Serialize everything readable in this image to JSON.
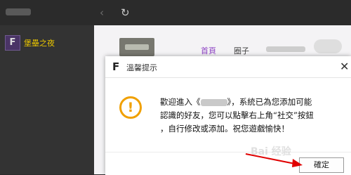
{
  "sidebar": {
    "items": [
      {
        "logo": "F",
        "label": "堡壘之夜"
      }
    ]
  },
  "nav": {
    "tabs": [
      {
        "label": "首頁"
      },
      {
        "label": "圈子"
      }
    ]
  },
  "dialog": {
    "logo": "F",
    "title": "溫馨提示",
    "message_line1_prefix": "歡迎進入《",
    "message_line1_suffix": "》，系統已為您添加可能",
    "message_line2": "認識的好友，您可以點擊右上角“社交”按鈕",
    "message_line3": "，自行修改或添加。祝您遊戲愉快！",
    "ok_label": "確定"
  },
  "watermark": "Bai 经验",
  "colors": {
    "accent_purple": "#8e44c4",
    "game_label_yellow": "#e8c400",
    "warning_orange": "#f0a000",
    "arrow_red": "#e00000"
  },
  "icons": {
    "back": "back-arrow-icon",
    "refresh": "refresh-icon",
    "warning": "exclamation-circle-icon",
    "close": "close-icon"
  }
}
